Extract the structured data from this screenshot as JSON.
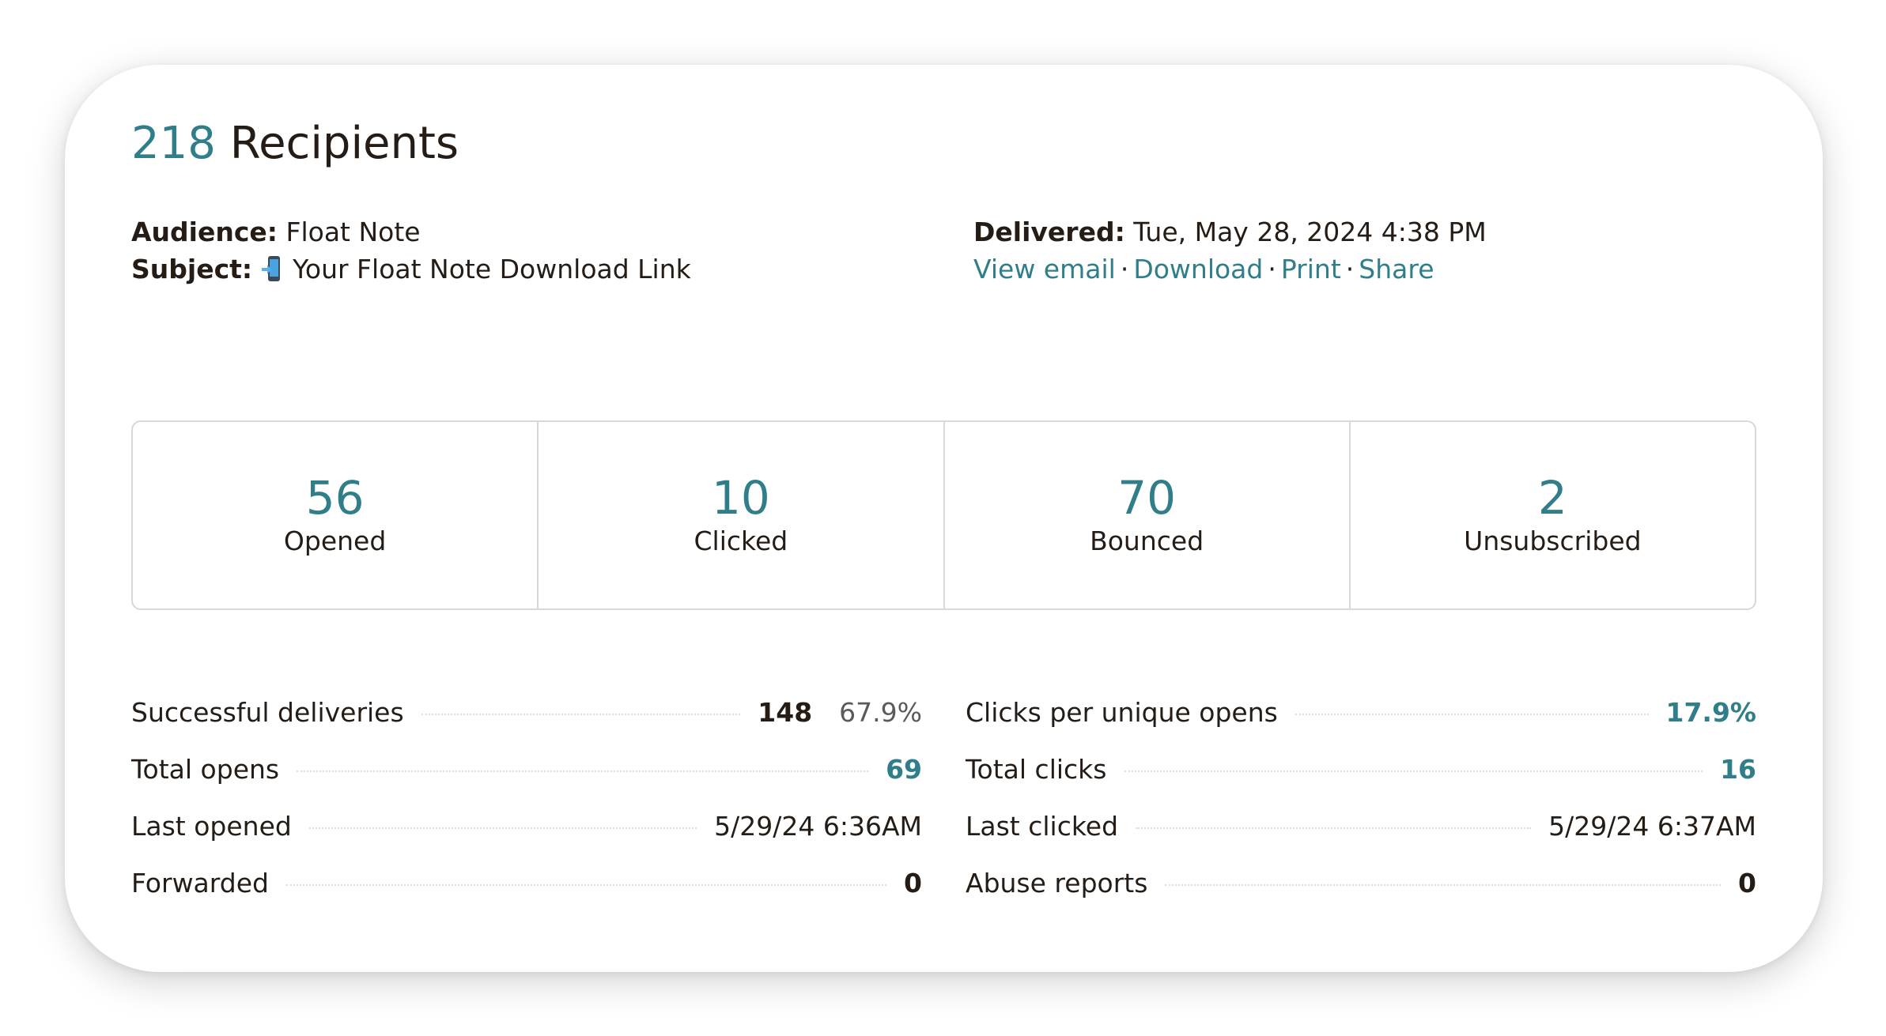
{
  "header": {
    "recipient_count": "218",
    "recipient_word": "Recipients"
  },
  "details": {
    "audience_label": "Audience:",
    "audience_value": "Float Note",
    "subject_label": "Subject:",
    "subject_value": "Your Float Note Download Link",
    "subject_icon": "mobile-phone-arrow-icon",
    "delivered_label": "Delivered:",
    "delivered_value": "Tue, May 28, 2024 4:38 PM"
  },
  "links": {
    "view_email": "View email",
    "download": "Download",
    "print": "Print",
    "share": "Share",
    "separator": "·"
  },
  "stats": [
    {
      "value": "56",
      "label": "Opened"
    },
    {
      "value": "10",
      "label": "Clicked"
    },
    {
      "value": "70",
      "label": "Bounced"
    },
    {
      "value": "2",
      "label": "Unsubscribed"
    }
  ],
  "metrics_left": [
    {
      "label": "Successful deliveries",
      "value": "148",
      "extra": "67.9%"
    },
    {
      "label": "Total opens",
      "value": "69"
    },
    {
      "label": "Last opened",
      "value": "5/29/24 6:36AM"
    },
    {
      "label": "Forwarded",
      "value": "0"
    }
  ],
  "metrics_right": [
    {
      "label": "Clicks per unique opens",
      "value": "17.9%"
    },
    {
      "label": "Total clicks",
      "value": "16"
    },
    {
      "label": "Last clicked",
      "value": "5/29/24 6:37AM"
    },
    {
      "label": "Abuse reports",
      "value": "0"
    }
  ],
  "colors": {
    "accent": "#2f7e89",
    "text": "#241c15",
    "border": "#d8d8d8"
  }
}
